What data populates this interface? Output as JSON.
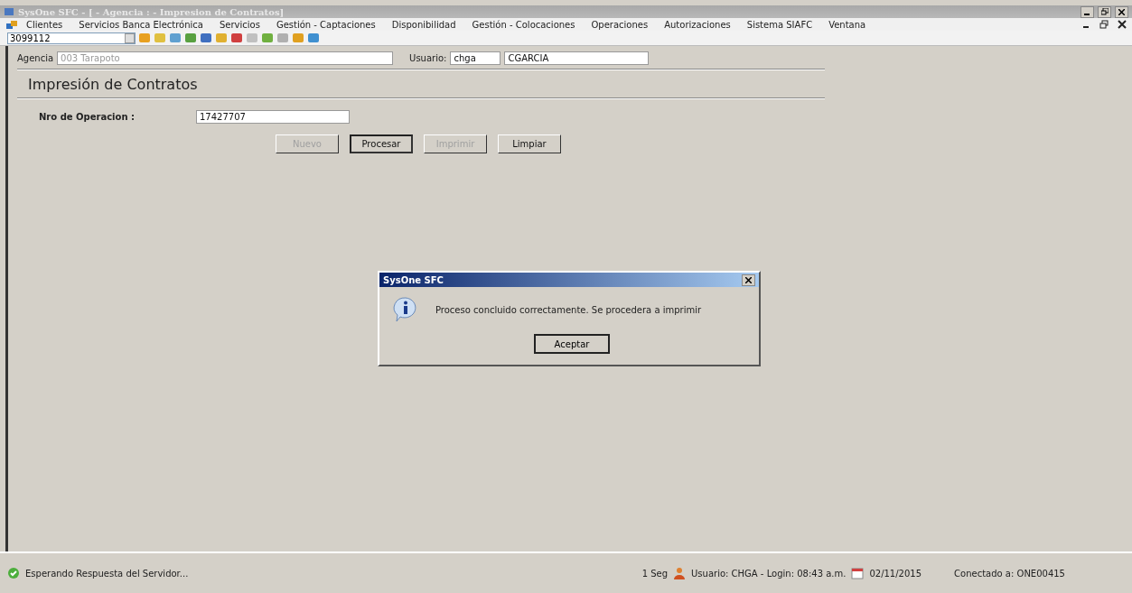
{
  "window": {
    "title": "SysOne SFC - [ - Agencia : - Impresion de Contratos]"
  },
  "menu": [
    "Clientes",
    "Servicios Banca Electrónica",
    "Servicios",
    "Gestión - Captaciones",
    "Disponibilidad",
    "Gestión - Colocaciones",
    "Operaciones",
    "Autorizaciones",
    "Sistema SIAFC",
    "Ventana"
  ],
  "toolbar": {
    "combo_value": "3099112"
  },
  "header": {
    "agencia_label": "Agencia",
    "agencia_value": "003 Tarapoto",
    "usuario_label": "Usuario:",
    "usuario_code": "chga",
    "usuario_name": "CGARCIA"
  },
  "form": {
    "title": "Impresión de Contratos",
    "operacion_label": "Nro de Operacion :",
    "operacion_value": "17427707",
    "buttons": [
      {
        "label": "Nuevo",
        "disabled": true,
        "default": false
      },
      {
        "label": "Procesar",
        "disabled": false,
        "default": true
      },
      {
        "label": "Imprimir",
        "disabled": true,
        "default": false
      },
      {
        "label": "Limpiar",
        "disabled": false,
        "default": false
      }
    ]
  },
  "dialog": {
    "title": "SysOne SFC",
    "message": "Proceso concluido correctamente. Se procedera a imprimir",
    "button": "Aceptar"
  },
  "status_bar": {
    "message": "Esperando Respuesta del Servidor...",
    "elapsed": "1 Seg",
    "user": "Usuario: CHGA - Login: 08:43 a.m.",
    "date": "02/11/2015",
    "connection": "Conectado a: ONE00415"
  }
}
